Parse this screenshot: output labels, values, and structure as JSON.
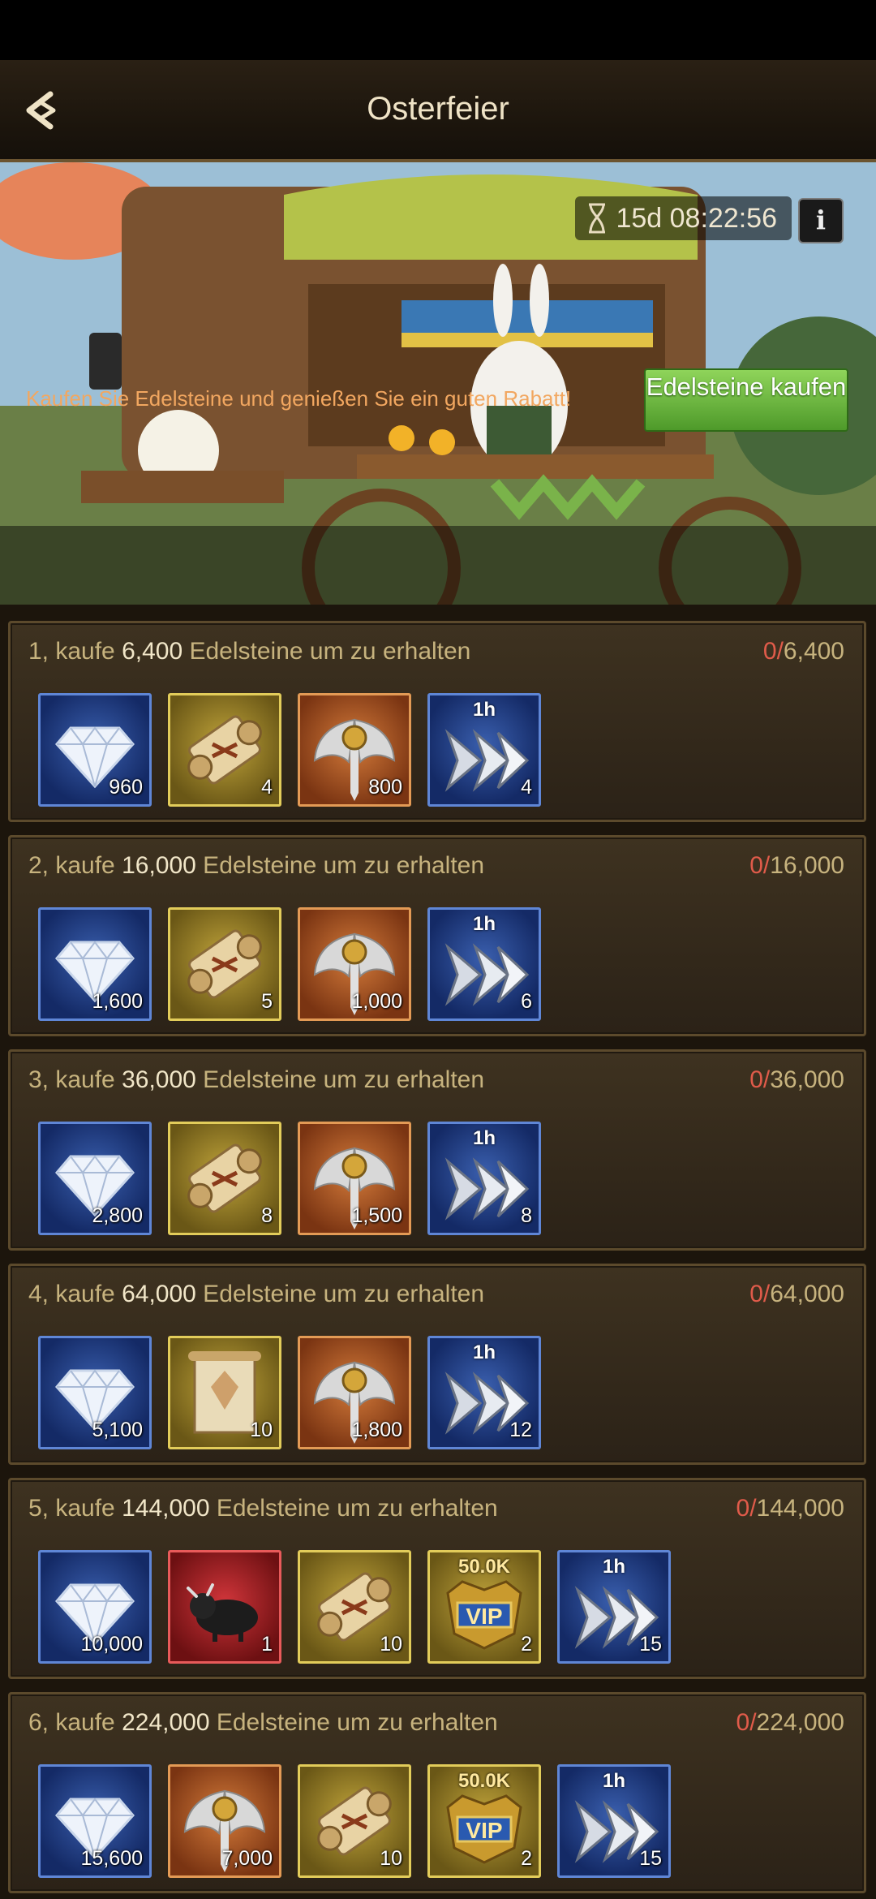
{
  "header": {
    "title": "Osterfeier"
  },
  "banner": {
    "timer": "15d 08:22:56",
    "promo_text": "Kaufen Sie Edelsteine und genießen Sie ein guten Rabatt!",
    "buy_button": "Edelsteine kaufen"
  },
  "tiers": [
    {
      "prefix": "1, kaufe",
      "amount": "6,400",
      "suffix": "Edelsteine um zu erhalten",
      "progress_current": "0/",
      "progress_total": "6,400",
      "items": [
        {
          "icon": "diamond-icon",
          "frame": "blue",
          "qty": "960"
        },
        {
          "icon": "scroll-icon",
          "frame": "gold",
          "qty": "4"
        },
        {
          "icon": "winged-sword-emblem-icon",
          "frame": "orange",
          "qty": "800"
        },
        {
          "icon": "speedup-arrows-icon",
          "frame": "blue",
          "qty": "4",
          "tag": "1h"
        }
      ]
    },
    {
      "prefix": "2, kaufe",
      "amount": "16,000",
      "suffix": "Edelsteine um zu erhalten",
      "progress_current": "0/",
      "progress_total": "16,000",
      "items": [
        {
          "icon": "diamond-icon",
          "frame": "blue",
          "qty": "1,600"
        },
        {
          "icon": "scroll-icon",
          "frame": "gold",
          "qty": "5"
        },
        {
          "icon": "winged-sword-emblem-icon",
          "frame": "orange",
          "qty": "1,000"
        },
        {
          "icon": "speedup-arrows-icon",
          "frame": "blue",
          "qty": "6",
          "tag": "1h"
        }
      ]
    },
    {
      "prefix": "3, kaufe",
      "amount": "36,000",
      "suffix": "Edelsteine um zu erhalten",
      "progress_current": "0/",
      "progress_total": "36,000",
      "items": [
        {
          "icon": "diamond-icon",
          "frame": "blue",
          "qty": "2,800"
        },
        {
          "icon": "scroll-icon",
          "frame": "gold",
          "qty": "8"
        },
        {
          "icon": "winged-sword-emblem-icon",
          "frame": "orange",
          "qty": "1,500"
        },
        {
          "icon": "speedup-arrows-icon",
          "frame": "blue",
          "qty": "8",
          "tag": "1h"
        }
      ]
    },
    {
      "prefix": "4, kaufe",
      "amount": "64,000",
      "suffix": "Edelsteine um zu erhalten",
      "progress_current": "0/",
      "progress_total": "64,000",
      "items": [
        {
          "icon": "diamond-icon",
          "frame": "blue",
          "qty": "5,100"
        },
        {
          "icon": "parchment-icon",
          "frame": "gold",
          "qty": "10"
        },
        {
          "icon": "winged-sword-emblem-icon",
          "frame": "orange",
          "qty": "1,800"
        },
        {
          "icon": "speedup-arrows-icon",
          "frame": "blue",
          "qty": "12",
          "tag": "1h"
        }
      ]
    },
    {
      "prefix": "5, kaufe",
      "amount": "144,000",
      "suffix": "Edelsteine um zu erhalten",
      "progress_current": "0/",
      "progress_total": "144,000",
      "items": [
        {
          "icon": "diamond-icon",
          "frame": "blue",
          "qty": "10,000"
        },
        {
          "icon": "bull-icon",
          "frame": "red",
          "qty": "1"
        },
        {
          "icon": "scroll-icon",
          "frame": "gold",
          "qty": "10"
        },
        {
          "icon": "vip-badge-icon",
          "frame": "gold",
          "qty": "2",
          "tag": "50.0K"
        },
        {
          "icon": "speedup-arrows-icon",
          "frame": "blue",
          "qty": "15",
          "tag": "1h"
        }
      ]
    },
    {
      "prefix": "6, kaufe",
      "amount": "224,000",
      "suffix": "Edelsteine um zu erhalten",
      "progress_current": "0/",
      "progress_total": "224,000",
      "items": [
        {
          "icon": "diamond-icon",
          "frame": "blue",
          "qty": "15,600"
        },
        {
          "icon": "winged-sword-emblem-icon",
          "frame": "orange",
          "qty": "7,000"
        },
        {
          "icon": "scroll-icon",
          "frame": "gold",
          "qty": "10"
        },
        {
          "icon": "vip-badge-icon",
          "frame": "gold",
          "qty": "2",
          "tag": "50.0K"
        },
        {
          "icon": "speedup-arrows-icon",
          "frame": "blue",
          "qty": "15",
          "tag": "1h"
        }
      ]
    }
  ]
}
